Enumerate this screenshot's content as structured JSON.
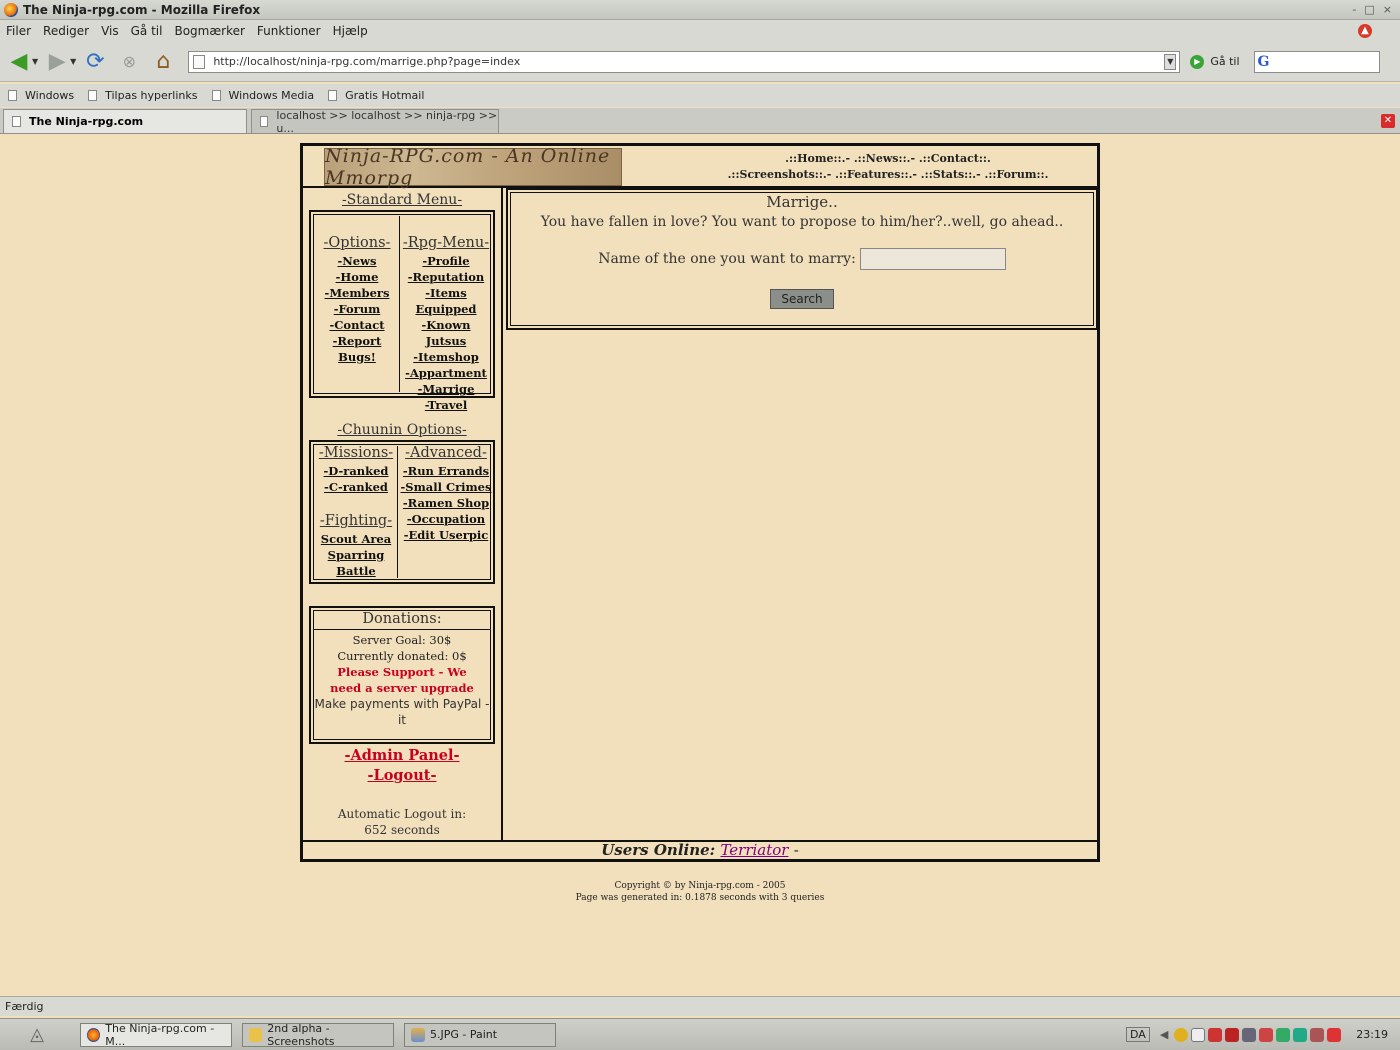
{
  "window": {
    "title": "The Ninja-rpg.com - Mozilla Firefox",
    "controls": [
      "-",
      "□",
      "×"
    ]
  },
  "menubar": [
    "Filer",
    "Rediger",
    "Vis",
    "Gå til",
    "Bogmærker",
    "Funktioner",
    "Hjælp"
  ],
  "toolbar": {
    "url": "http://localhost/ninja-rpg.com/marrige.php?page=index",
    "go_label": "Gå til",
    "search_icon": "G"
  },
  "bookmarks": [
    "Windows",
    "Tilpas hyperlinks",
    "Windows Media",
    "Gratis Hotmail"
  ],
  "tabs": [
    {
      "label": "The Ninja-rpg.com",
      "active": true
    },
    {
      "label": "localhost >> localhost >> ninja-rpg  >> u...",
      "active": false
    }
  ],
  "site": {
    "logo": "Ninja-RPG.com - An Online Mmorpg",
    "nav_line1": ".::Home::.- .::News::.- .::Contact::.",
    "nav_line2": ".::Screenshots::.- .::Features::.- .::Stats::.- .::Forum::.",
    "standard_menu_title": "-Standard Menu-",
    "options_title": "-Options-",
    "options": [
      "-News",
      "-Home",
      "-Members",
      "-Forum",
      "-Contact",
      "-Report Bugs!"
    ],
    "rpg_title": "-Rpg-Menu-",
    "rpg": [
      "-Profile",
      "-Reputation",
      "-Items Equipped",
      "-Known Jutsus",
      "-Itemshop",
      "-Appartment",
      "-Marrige",
      "-Travel"
    ],
    "chuunin_title": "-Chuunin Options-",
    "missions_title": "-Missions-",
    "missions": [
      "-D-ranked",
      "-C-ranked"
    ],
    "fighting_title": "-Fighting-",
    "fighting": [
      "Scout Area",
      "Sparring",
      "Battle"
    ],
    "advanced_title": "-Advanced-",
    "advanced": [
      "-Run Errands",
      "-Small Crimes",
      "-Ramen Shop",
      "-Occupation",
      "-Edit Userpic"
    ],
    "donations": {
      "title": "Donations:",
      "goal": "Server Goal: 30$",
      "donated": "Currently donated: 0$",
      "support": "Please Support - We need a server upgrade",
      "paypal": "Make payments with PayPal - it"
    },
    "admin_panel": "-Admin Panel-",
    "logout": "-Logout-",
    "auto_logout_label": "Automatic Logout in:",
    "auto_logout_value": "652 seconds",
    "main": {
      "title": "Marrige..",
      "intro": "You have fallen in love? You want to propose to him/her?..well, go ahead..",
      "name_label": "Name of the one you want to marry:",
      "name_value": "",
      "search_button": "Search"
    },
    "users_online_label": "Users Online:",
    "users_online_user": "Terriator",
    "users_online_suffix": "-"
  },
  "copyright": {
    "line1": "Copyright © by Ninja-rpg.com - 2005",
    "line2": "Page was generated in: 0.1878 seconds with 3 queries"
  },
  "statusbar": {
    "text": "Færdig"
  },
  "taskbar": {
    "tasks": [
      {
        "label": "The Ninja-rpg.com - M...",
        "active": true
      },
      {
        "label": "2nd alpha - Screenshots",
        "active": false
      },
      {
        "label": "5.JPG - Paint",
        "active": false
      }
    ],
    "lang": "DA",
    "clock": "23:19"
  },
  "colors": {
    "page_bg": "#f2e0bd",
    "admin_red": "#c8001e",
    "user_link": "#800080",
    "chrome": "#d8d9d3"
  }
}
